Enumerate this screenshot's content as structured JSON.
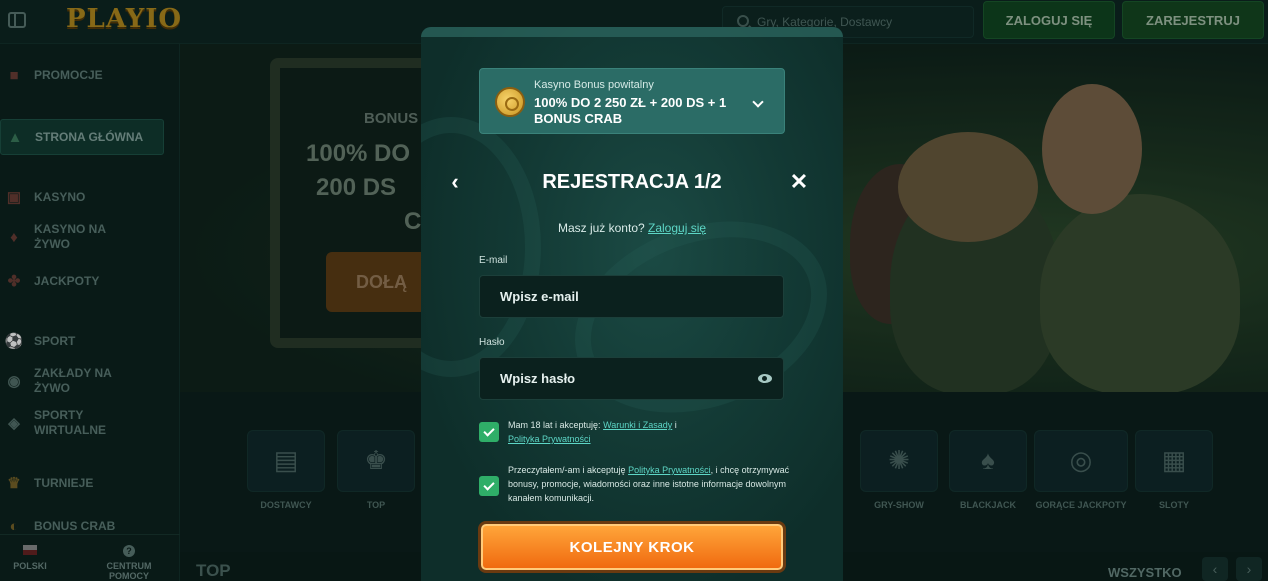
{
  "header": {
    "logo": "PLAYIO",
    "search_placeholder": "Gry, Kategorie, Dostawcy",
    "login_label": "ZALOGUJ SIĘ",
    "register_label": "ZAREJESTRUJ"
  },
  "sidebar": {
    "items": [
      {
        "label": "PROMOCJE",
        "icon": "gift-icon"
      },
      {
        "label": "STRONA GŁÓWNA",
        "icon": "home-icon"
      },
      {
        "label": "KASYNO",
        "icon": "slot-machine-icon"
      },
      {
        "label": "KASYNO NA ŻYWO",
        "icon": "cards-icon"
      },
      {
        "label": "JACKPOTY",
        "icon": "clover-icon"
      },
      {
        "label": "SPORT",
        "icon": "ball-icon"
      },
      {
        "label": "ZAKŁADY NA ŻYWO",
        "icon": "live-icon"
      },
      {
        "label": "SPORTY WIRTUALNE",
        "icon": "gamepad-icon"
      },
      {
        "label": "TURNIEJE",
        "icon": "trophy-icon"
      },
      {
        "label": "BONUS CRAB",
        "icon": "crab-icon"
      }
    ],
    "language": "POLSKI",
    "help": "CENTRUM POMOCY"
  },
  "hero": {
    "small": "BONUS",
    "line1": "100% DO",
    "line2": "200 DS",
    "line3": "C",
    "cta": "DOŁĄ"
  },
  "categories": [
    {
      "label": "DOSTAWCY",
      "icon": "list-icon"
    },
    {
      "label": "TOP",
      "icon": "crown-icon"
    },
    {
      "label": "GRY-SHOW",
      "icon": "wheel-icon"
    },
    {
      "label": "BLACKJACK",
      "icon": "spade-icon"
    },
    {
      "label": "GORĄCE JACKPOTY",
      "icon": "fire-coin-icon"
    },
    {
      "label": "SLOTY",
      "icon": "slot-icon"
    }
  ],
  "section": {
    "title": "TOP",
    "see_all": "WSZYSTKO"
  },
  "modal": {
    "bonus_subtitle": "Kasyno Bonus powitalny",
    "bonus_title": "100% DO 2 250 ZŁ + 200 DS + 1 BONUS CRAB",
    "title": "REJESTRACJA 1/2",
    "have_account": "Masz już konto?",
    "login_link": "Zaloguj się",
    "email_label": "E-mail",
    "email_placeholder": "Wpisz e-mail",
    "password_label": "Hasło",
    "password_placeholder": "Wpisz hasło",
    "consent1_text": "Mam 18 lat i akceptuję:",
    "consent1_link1": "Warunki i Zasady",
    "consent1_and": "i",
    "consent1_link2": "Polityka Prywatności",
    "consent2_text1": "Przeczytałem/-am i akceptuję",
    "consent2_link": "Polityka Prywatności",
    "consent2_text2": ", i chcę otrzymywać bonusy, promocje, wiadomości oraz inne istotne informacje dowolnym kanałem komunikacji.",
    "submit_label": "KOLEJNY KROK"
  },
  "colors": {
    "accent_green": "#2fae68",
    "link": "#5dd6c6",
    "cta_orange": "#f06a10",
    "modal_bg": "#133a35"
  }
}
